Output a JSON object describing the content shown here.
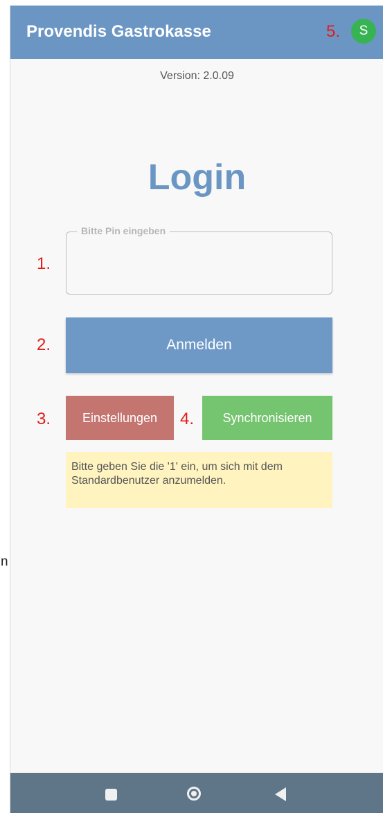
{
  "page_edge_text": "n",
  "appbar": {
    "title": "Provendis Gastrokasse",
    "avatar_letter": "S",
    "marker": "5."
  },
  "version": "Version: 2.0.09",
  "login": {
    "title": "Login",
    "pin_label": "Bitte Pin eingeben",
    "pin_value": "",
    "pin_marker": "1.",
    "submit_label": "Anmelden",
    "submit_marker": "2."
  },
  "actions": {
    "settings_label": "Einstellungen",
    "settings_marker": "3.",
    "sync_label": "Synchronisieren",
    "sync_marker": "4."
  },
  "hint": "Bitte geben Sie die '1' ein, um sich mit dem Standardbenutzer anzumelden.",
  "nav": {
    "icons": [
      "recents-icon",
      "home-icon",
      "back-icon"
    ]
  },
  "colors": {
    "primary": "#6b96c4",
    "settings": "#c47570",
    "sync": "#75c46f",
    "avatar": "#37b354",
    "hint_bg": "#fff3c0",
    "marker": "#e11b1b",
    "navbar": "#5f7689"
  }
}
